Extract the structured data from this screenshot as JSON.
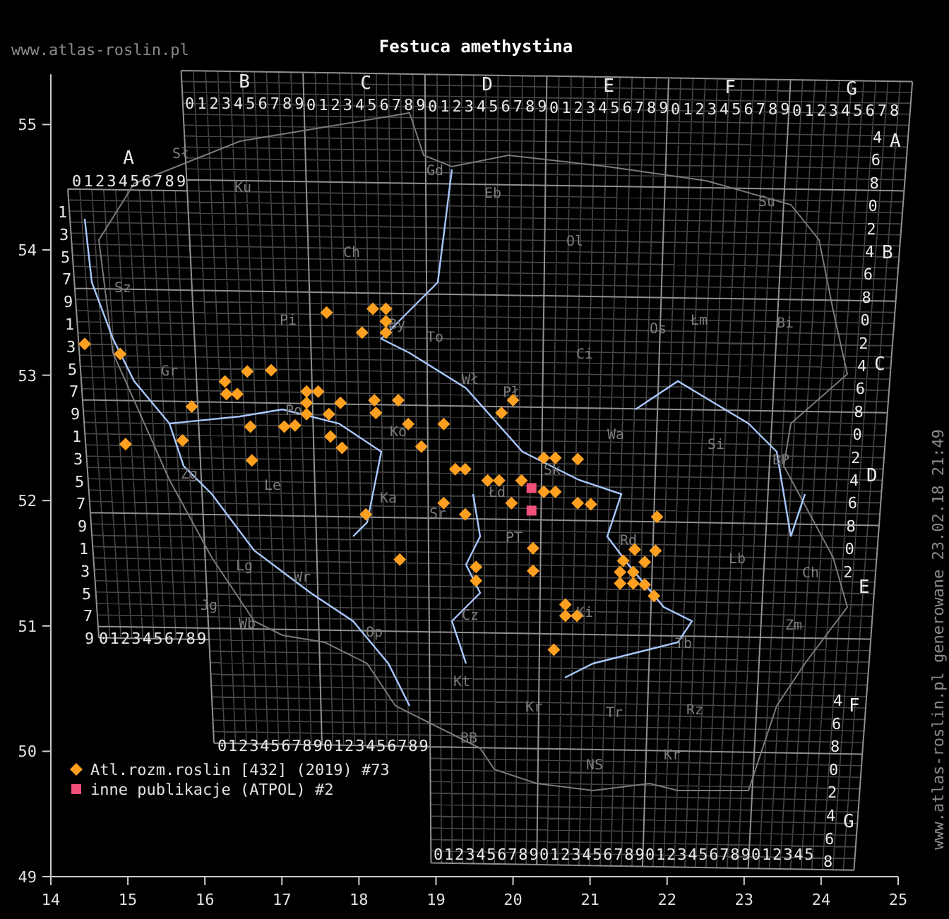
{
  "header": {
    "site": "www.atlas-roslin.pl",
    "title": "Festuca amethystina"
  },
  "map": {
    "chart_data": {
      "type": "scatter",
      "legend": "lower left",
      "xlim": [
        14,
        25
      ],
      "ylim": [
        49,
        55.4
      ],
      "xticks": [
        14,
        15,
        16,
        17,
        18,
        19,
        20,
        21,
        22,
        23,
        24,
        25
      ],
      "yticks": [
        49,
        50,
        51,
        52,
        53,
        54,
        55
      ],
      "series": [
        {
          "name": "Atl.rozm.roslin [432] (2019) #73",
          "color": "#ffa020",
          "x": [
            17.58,
            18.18,
            18.35,
            18.35,
            18.04,
            18.35,
            16.55,
            16.86,
            16.26,
            16.28,
            16.42,
            15.83,
            17.32,
            17.47,
            17.32,
            17.32,
            17.76,
            17.61,
            18.2,
            18.22,
            18.51,
            20.0,
            19.85,
            16.59,
            17.03,
            17.17,
            18.64,
            19.1,
            15.71,
            17.63,
            17.78,
            18.81,
            16.61,
            20.4,
            20.55,
            20.84,
            14.44,
            14.9,
            14.97,
            19.25,
            19.38,
            19.67,
            19.82,
            20.11,
            20.4,
            20.55,
            19.1,
            19.98,
            20.84,
            21.01,
            18.09,
            19.38,
            21.87,
            20.26,
            21.58,
            21.85,
            21.43,
            21.71,
            18.53,
            19.52,
            19.52,
            20.26,
            21.39,
            21.56,
            21.39,
            21.56,
            21.71,
            21.83,
            20.68,
            20.68,
            20.83,
            20.53
          ],
          "values": [
            53.5,
            53.53,
            53.53,
            53.43,
            53.34,
            53.34,
            53.03,
            53.04,
            52.95,
            52.85,
            52.85,
            52.75,
            52.87,
            52.87,
            52.78,
            52.69,
            52.78,
            52.69,
            52.8,
            52.7,
            52.8,
            52.8,
            52.7,
            52.59,
            52.59,
            52.6,
            52.61,
            52.61,
            52.48,
            52.51,
            52.42,
            52.43,
            52.32,
            52.34,
            52.34,
            52.33,
            53.25,
            53.17,
            52.45,
            52.25,
            52.25,
            52.16,
            52.16,
            52.16,
            52.07,
            52.07,
            51.98,
            51.98,
            51.98,
            51.97,
            51.89,
            51.89,
            51.87,
            51.62,
            51.61,
            51.6,
            51.52,
            51.51,
            51.53,
            51.47,
            51.36,
            51.44,
            51.43,
            51.43,
            51.34,
            51.34,
            51.33,
            51.24,
            51.17,
            51.08,
            51.08,
            50.81
          ]
        },
        {
          "name": "inne publikacje (ATPOL) #2",
          "color": "#f0507a",
          "x": [
            20.24,
            20.24
          ],
          "values": [
            52.1,
            51.92
          ]
        }
      ]
    },
    "grid_labels": {
      "column_letters": [
        "A",
        "B",
        "C",
        "D",
        "E",
        "F",
        "G"
      ],
      "top_runs": [
        "0123456789",
        "0123456789",
        "0123456789",
        "0123456789",
        "0123456789",
        "0123456789",
        "012345678"
      ],
      "bottom_runs": [
        "0123456789",
        "0123456789",
        "0123456789",
        "0123456789",
        "0123456789",
        "0123456789",
        "012345"
      ],
      "left_rows": [
        "1",
        "3",
        "5",
        "7",
        "9",
        "1",
        "3",
        "5",
        "7",
        "9",
        "1",
        "3",
        "5",
        "7",
        "9",
        "1",
        "3",
        "5",
        "7",
        "9"
      ],
      "right_rows_upper": [
        "4",
        "6",
        "8",
        "0",
        "2",
        "4",
        "6",
        "8",
        "0",
        "2",
        "4",
        "6",
        "8",
        "0",
        "2",
        "4",
        "6",
        "8",
        "0",
        "2"
      ],
      "right_letters_upper": [
        "A",
        "B",
        "C",
        "D",
        "E"
      ],
      "right_rows_lower": [
        "4",
        "6",
        "8",
        "0",
        "2",
        "4",
        "6",
        "8"
      ],
      "right_letters_lower": [
        "F",
        "G"
      ]
    },
    "regions": [
      "Sł",
      "Ku",
      "Gd",
      "Eb",
      "Su",
      "Ch",
      "Ol",
      "Sz",
      "Pi",
      "By",
      "To",
      "Os",
      "Łm",
      "Bi",
      "Gr",
      "Wł",
      "Ci",
      "Po",
      "Pł",
      "Ko",
      "Wa",
      "Si",
      "BP",
      "Zg",
      "Le",
      "Ka",
      "Łd",
      "Sk",
      "Sr",
      "PT",
      "Rd",
      "Lg",
      "Wr",
      "Lb",
      "Ch",
      "Jg",
      "Wb",
      "Op",
      "Cz",
      "Ki",
      "Tb",
      "Zm",
      "Kt",
      "Kr",
      "Tr",
      "Rz",
      "BB",
      "NS",
      "Kr"
    ]
  },
  "credit": "www.atlas-roslin.pl generowane 23.02.18 21:49"
}
